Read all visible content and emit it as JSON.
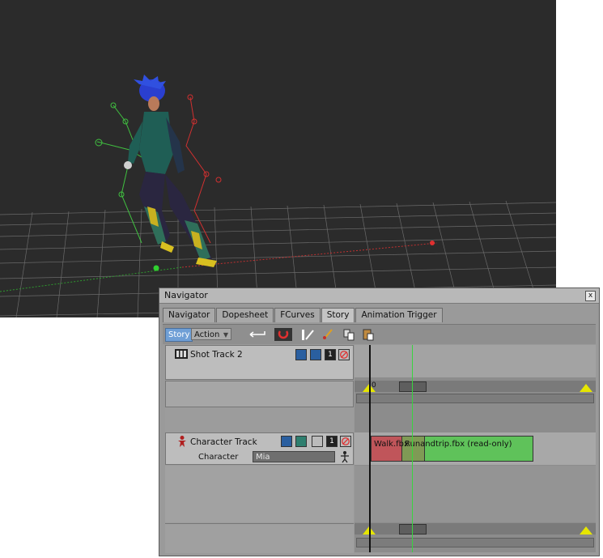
{
  "window": {
    "title": "Navigator",
    "close_label": "x"
  },
  "tabs": [
    {
      "label": "Navigator"
    },
    {
      "label": "Dopesheet"
    },
    {
      "label": "FCurves"
    },
    {
      "label": "Story",
      "active": true
    },
    {
      "label": "Animation Trigger"
    }
  ],
  "toolbar": {
    "story_label": "Story",
    "action_label": "Action"
  },
  "tracks": {
    "shot_track_label": "Shot Track 2",
    "character_track_label": "Character Track",
    "character_field_label": "Character",
    "character_value": "Mia"
  },
  "timeline": {
    "start_frame": "0",
    "clip_walk_label": "Walk.fbx",
    "clip_run_label": "Runandtrip.fbx (read-only)"
  },
  "colors": {
    "viewport_bg": "#2b2b2b",
    "clip_walk": "#c0555a",
    "clip_run": "#5fc25a",
    "playhead": "#39d43f",
    "story_button": "#6f9fd6"
  },
  "icons": [
    "film-strip-icon",
    "person-icon",
    "magnet-icon",
    "cut-icon",
    "copy-icon",
    "paste-icon",
    "camera-icon",
    "mute-icon"
  ]
}
